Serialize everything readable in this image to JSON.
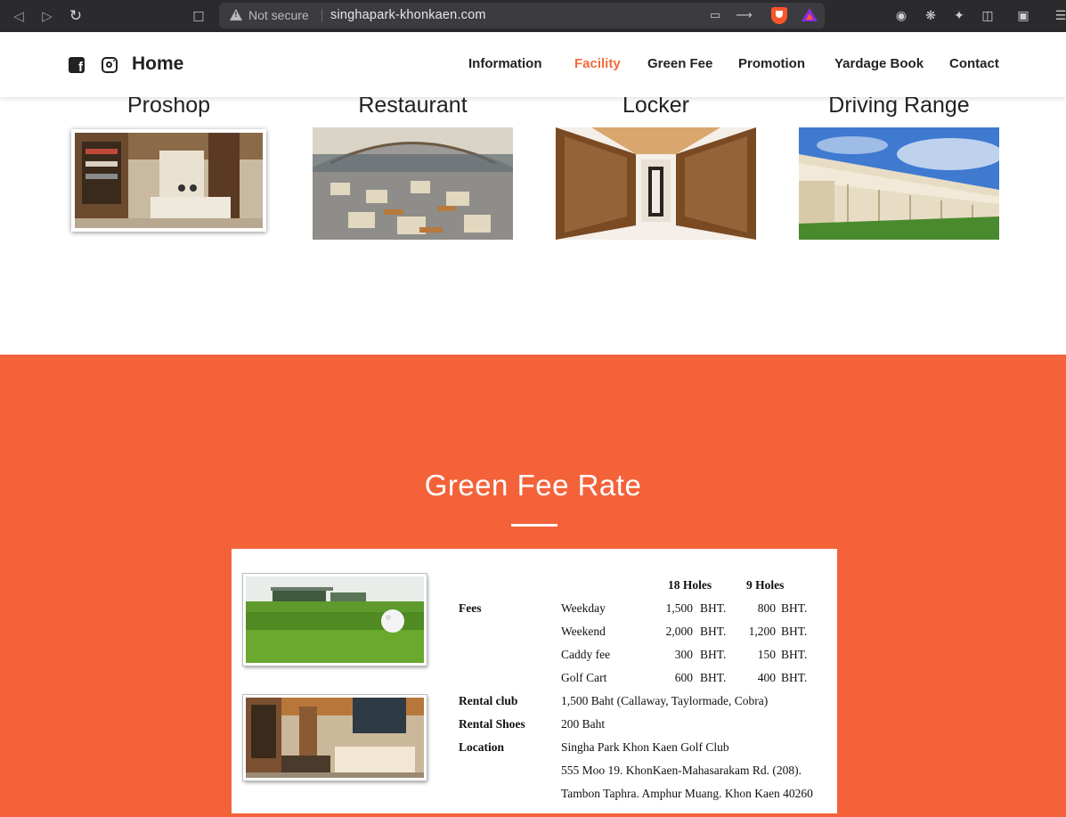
{
  "browser": {
    "security_label": "Not secure",
    "url": "singhapark-khonkaen.com"
  },
  "header": {
    "home_label": "Home",
    "nav": [
      "Information",
      "Facility",
      "Green Fee",
      "Promotion",
      "Yardage Book",
      "Contact"
    ],
    "active_nav": "Facility"
  },
  "facilities": [
    {
      "title": "Proshop"
    },
    {
      "title": "Restaurant"
    },
    {
      "title": "Locker"
    },
    {
      "title": "Driving Range"
    }
  ],
  "green_fee": {
    "title": "Green Fee Rate",
    "col_18": "18 Holes",
    "col_9": "9 Holes",
    "fees_label": "Fees",
    "fees": [
      {
        "name": "Weekday",
        "h18": "1,500",
        "h18_unit": "BHT.",
        "h9": "800",
        "h9_unit": "BHT."
      },
      {
        "name": "Weekend",
        "h18": "2,000",
        "h18_unit": "BHT.",
        "h9": "1,200",
        "h9_unit": "BHT."
      },
      {
        "name": "Caddy fee",
        "h18": "300",
        "h18_unit": "BHT.",
        "h9": "150",
        "h9_unit": "BHT."
      },
      {
        "name": "Golf Cart",
        "h18": "600",
        "h18_unit": "BHT.",
        "h9": "400",
        "h9_unit": "BHT."
      }
    ],
    "rental_club_label": "Rental club",
    "rental_club_value": "1,500 Baht (Callaway, Taylormade, Cobra)",
    "rental_shoes_label": "Rental Shoes",
    "rental_shoes_value": "200 Baht",
    "location_label": "Location",
    "location_lines": [
      "Singha Park Khon Kaen Golf Club",
      "555 Moo 19. KhonKaen-Mahasarakam Rd. (208).",
      "Tambon Taphra. Amphur Muang. Khon Kaen 40260"
    ]
  },
  "colors": {
    "accent": "#f4623a",
    "nav_active": "#f26a3f"
  }
}
